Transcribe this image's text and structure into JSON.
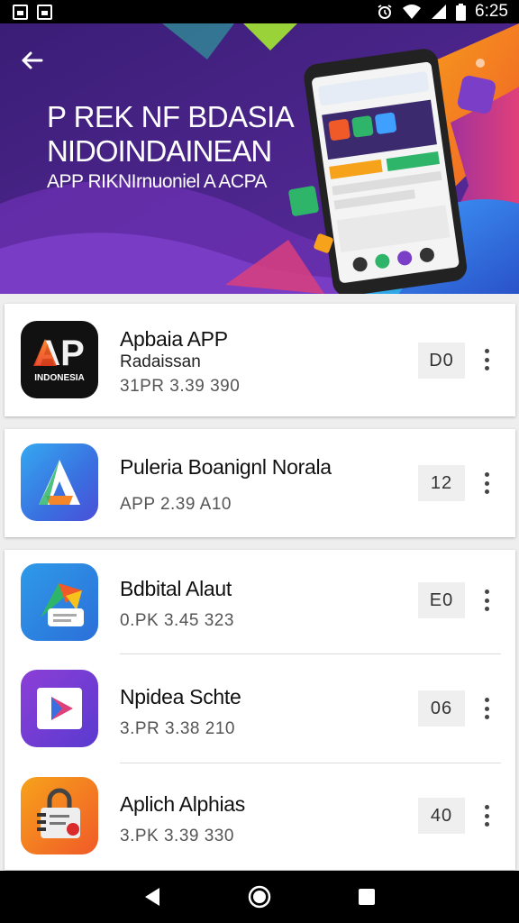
{
  "status_bar": {
    "time": "6:25"
  },
  "banner": {
    "title_line1": "P REK NF BDASIA",
    "title_line2": "NIDOINDAINEAN",
    "subtitle": "APP RIKNIrnuoniel A ACPA"
  },
  "apps": [
    {
      "name": "Apbaia APP",
      "developer": "Radaissan",
      "meta": "31PR  3.39 390",
      "badge": "D0",
      "icon": "ap-indonesia-logo-icon",
      "icon_text_big": "AP",
      "icon_text_small": "INDONESIA"
    },
    {
      "name": "Puleria Boanignl Norala",
      "meta": "APP  2.39 A10",
      "badge": "12",
      "icon": "blue-a-triangle-icon"
    },
    {
      "name": "Bdbital Alaut",
      "meta": "0.PK  3.45 323",
      "badge": "E0",
      "icon": "colorful-stack-icon"
    },
    {
      "name": "Npidea Schte",
      "meta": "3.PR  3.38 210",
      "badge": "06",
      "icon": "purple-play-icon"
    },
    {
      "name": "Aplich Alphias",
      "meta": "3.PK  3.39 330",
      "badge": "40",
      "icon": "orange-lock-doc-icon"
    }
  ],
  "colors": {
    "banner_bg": "#4a2a8f",
    "card_bg": "#ffffff",
    "page_bg": "#eeeeee"
  }
}
